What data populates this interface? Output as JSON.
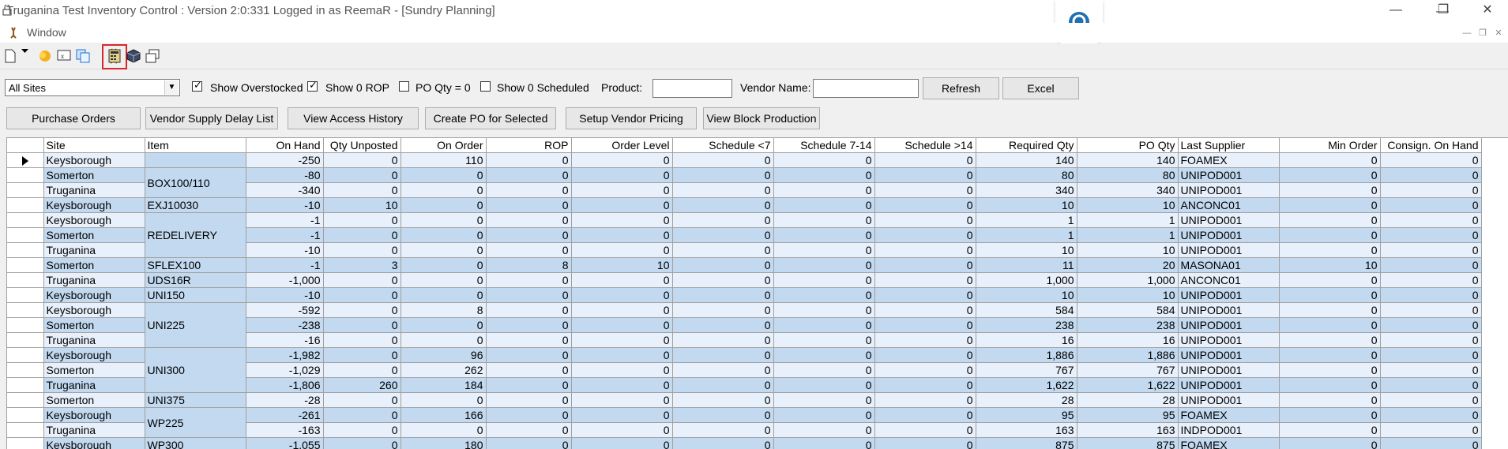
{
  "window": {
    "title": "Truganina Test Inventory Control : Version 2:0:331 Logged in as ReemaR - [Sundry Planning]",
    "menu_window": "Window",
    "controls": {
      "minimize": "—",
      "restore": "❐",
      "close": "✕"
    }
  },
  "toolbar": {
    "icons": [
      "new-document-icon",
      "dropdown-arrow-icon",
      "open-folder-icon",
      "excel-sheet-icon",
      "copy-windows-icon",
      "reindeer-app-icon",
      "calculator-icon",
      "cube-package-icon",
      "cascade-windows-icon"
    ]
  },
  "filters": {
    "site_select_value": "All Sites",
    "show_overstocked": {
      "label": "Show Overstocked",
      "checked": true
    },
    "show_zero_rop": {
      "label": "Show 0 ROP",
      "checked": true
    },
    "po_qty_zero": {
      "label": "PO Qty = 0",
      "checked": false
    },
    "show_zero_scheduled": {
      "label": "Show 0 Scheduled",
      "checked": false
    },
    "product_label": "Product:",
    "product_value": "",
    "vendor_label": "Vendor Name:",
    "vendor_value": "",
    "refresh_label": "Refresh",
    "excel_label": "Excel"
  },
  "actions": {
    "purchase_orders": "Purchase Orders",
    "vendor_supply_delay": "Vendor Supply Delay List",
    "view_access_history": "View Access History",
    "create_po": "Create PO for Selected",
    "setup_vendor_pricing": "Setup Vendor Pricing",
    "view_block_production": "View Block Production"
  },
  "grid": {
    "columns": [
      "Site",
      "Item",
      "On Hand",
      "Qty Unposted",
      "On Order",
      "ROP",
      "Order Level",
      "Schedule <7",
      "Schedule 7-14",
      "Schedule >14",
      "Required Qty",
      "PO Qty",
      "Last Supplier",
      "Min Order",
      "Consign. On Hand"
    ],
    "groups": [
      {
        "item": "",
        "rows": [
          [
            "Keysborough",
            "-250",
            "0",
            "110",
            "0",
            "0",
            "0",
            "0",
            "0",
            "140",
            "140",
            "FOAMEX",
            "0",
            "0"
          ]
        ]
      },
      {
        "item": "BOX100/110",
        "rows": [
          [
            "Somerton",
            "-80",
            "0",
            "0",
            "0",
            "0",
            "0",
            "0",
            "0",
            "80",
            "80",
            "UNIPOD001",
            "0",
            "0"
          ],
          [
            "Truganina",
            "-340",
            "0",
            "0",
            "0",
            "0",
            "0",
            "0",
            "0",
            "340",
            "340",
            "UNIPOD001",
            "0",
            "0"
          ]
        ]
      },
      {
        "item": "EXJ10030",
        "rows": [
          [
            "Keysborough",
            "-10",
            "10",
            "0",
            "0",
            "0",
            "0",
            "0",
            "0",
            "10",
            "10",
            "ANCONC01",
            "0",
            "0"
          ]
        ]
      },
      {
        "item": "REDELIVERY",
        "rows": [
          [
            "Keysborough",
            "-1",
            "0",
            "0",
            "0",
            "0",
            "0",
            "0",
            "0",
            "1",
            "1",
            "UNIPOD001",
            "0",
            "0"
          ],
          [
            "Somerton",
            "-1",
            "0",
            "0",
            "0",
            "0",
            "0",
            "0",
            "0",
            "1",
            "1",
            "UNIPOD001",
            "0",
            "0"
          ],
          [
            "Truganina",
            "-10",
            "0",
            "0",
            "0",
            "0",
            "0",
            "0",
            "0",
            "10",
            "10",
            "UNIPOD001",
            "0",
            "0"
          ]
        ]
      },
      {
        "item": "SFLEX100",
        "rows": [
          [
            "Somerton",
            "-1",
            "3",
            "0",
            "8",
            "10",
            "0",
            "0",
            "0",
            "11",
            "20",
            "MASONA01",
            "10",
            "0"
          ]
        ]
      },
      {
        "item": "UDS16R",
        "rows": [
          [
            "Truganina",
            "-1,000",
            "0",
            "0",
            "0",
            "0",
            "0",
            "0",
            "0",
            "1,000",
            "1,000",
            "ANCONC01",
            "0",
            "0"
          ]
        ]
      },
      {
        "item": "UNI150",
        "rows": [
          [
            "Keysborough",
            "-10",
            "0",
            "0",
            "0",
            "0",
            "0",
            "0",
            "0",
            "10",
            "10",
            "UNIPOD001",
            "0",
            "0"
          ]
        ]
      },
      {
        "item": "UNI225",
        "rows": [
          [
            "Keysborough",
            "-592",
            "0",
            "8",
            "0",
            "0",
            "0",
            "0",
            "0",
            "584",
            "584",
            "UNIPOD001",
            "0",
            "0"
          ],
          [
            "Somerton",
            "-238",
            "0",
            "0",
            "0",
            "0",
            "0",
            "0",
            "0",
            "238",
            "238",
            "UNIPOD001",
            "0",
            "0"
          ],
          [
            "Truganina",
            "-16",
            "0",
            "0",
            "0",
            "0",
            "0",
            "0",
            "0",
            "16",
            "16",
            "UNIPOD001",
            "0",
            "0"
          ]
        ]
      },
      {
        "item": "UNI300",
        "rows": [
          [
            "Keysborough",
            "-1,982",
            "0",
            "96",
            "0",
            "0",
            "0",
            "0",
            "0",
            "1,886",
            "1,886",
            "UNIPOD001",
            "0",
            "0"
          ],
          [
            "Somerton",
            "-1,029",
            "0",
            "262",
            "0",
            "0",
            "0",
            "0",
            "0",
            "767",
            "767",
            "UNIPOD001",
            "0",
            "0"
          ],
          [
            "Truganina",
            "-1,806",
            "260",
            "184",
            "0",
            "0",
            "0",
            "0",
            "0",
            "1,622",
            "1,622",
            "UNIPOD001",
            "0",
            "0"
          ]
        ]
      },
      {
        "item": "UNI375",
        "rows": [
          [
            "Somerton",
            "-28",
            "0",
            "0",
            "0",
            "0",
            "0",
            "0",
            "0",
            "28",
            "28",
            "UNIPOD001",
            "0",
            "0"
          ]
        ]
      },
      {
        "item": "WP225",
        "rows": [
          [
            "Keysborough",
            "-261",
            "0",
            "166",
            "0",
            "0",
            "0",
            "0",
            "0",
            "95",
            "95",
            "FOAMEX",
            "0",
            "0"
          ],
          [
            "Truganina",
            "-163",
            "0",
            "0",
            "0",
            "0",
            "0",
            "0",
            "0",
            "163",
            "163",
            "INDPOD001",
            "0",
            "0"
          ]
        ]
      },
      {
        "item": "WP300",
        "rows": [
          [
            "Keysborough",
            "-1,055",
            "0",
            "180",
            "0",
            "0",
            "0",
            "0",
            "0",
            "875",
            "875",
            "FOAMEX",
            "0",
            "0"
          ]
        ]
      }
    ]
  },
  "colors": {
    "row_light": "#e7f0fb",
    "row_dark": "#c2d9ef",
    "highlight_border": "#d9252c"
  }
}
